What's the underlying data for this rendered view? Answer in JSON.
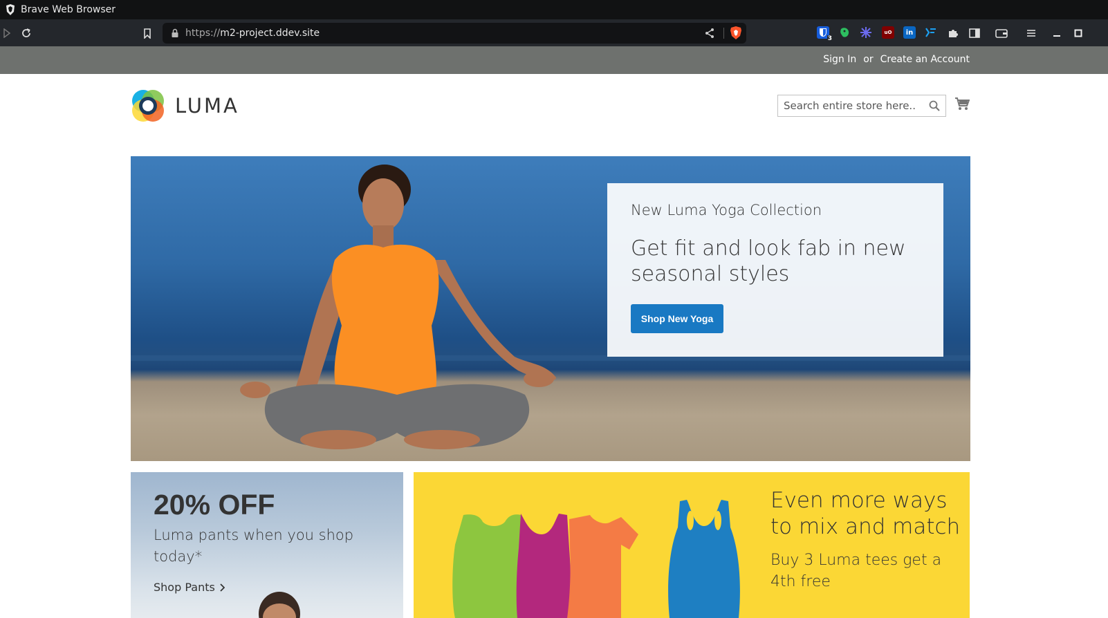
{
  "window": {
    "title": "Brave Web Browser"
  },
  "browser": {
    "url_scheme": "https://",
    "url_host": "m2-project.ddev.site",
    "extensions": [
      {
        "name": "bitwarden-icon",
        "color": "#175ddc",
        "badge": "3"
      },
      {
        "name": "evernote-icon",
        "color": "#2dbe60"
      },
      {
        "name": "snowflake-icon",
        "color": "#5b5bd6"
      },
      {
        "name": "ublock-icon",
        "color": "#800000"
      },
      {
        "name": "linkedin-icon",
        "color": "#0a66c2"
      },
      {
        "name": "devtools-icon",
        "color": "#1ca0f2"
      }
    ]
  },
  "header": {
    "sign_in": "Sign In",
    "or": "or",
    "create_account": "Create an Account"
  },
  "store": {
    "logo_text": "LUMA",
    "search_placeholder": "Search entire store here..."
  },
  "hero": {
    "subtitle": "New Luma Yoga Collection",
    "title": "Get fit and look fab in new seasonal styles",
    "button": "Shop New Yoga"
  },
  "promo_pants": {
    "headline": "20% OFF",
    "text": "Luma pants when you shop today*",
    "link": "Shop Pants"
  },
  "promo_tees": {
    "title": "Even more ways to mix and match",
    "subtitle": "Buy 3 Luma tees get a 4th free"
  },
  "colors": {
    "accent": "#1979c3",
    "header_bg": "#6e716e",
    "promo_yellow": "#fbd735"
  }
}
